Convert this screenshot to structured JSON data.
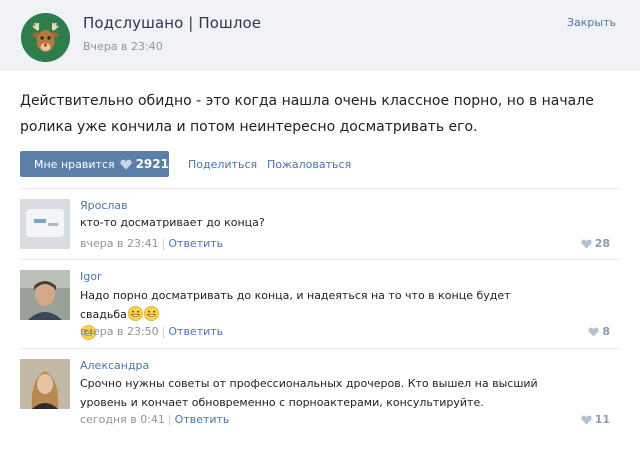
{
  "header": {
    "title": "Подслушано | Пошлое",
    "time": "Вчера в 23:40",
    "close_label": "Закрыть"
  },
  "post": {
    "text": "Действительно обидно - это когда нашла очень классное порно, но в начале ролика уже кончила и потом неинтересно досматривать его."
  },
  "actions": {
    "like_label": "Мне нравится",
    "like_count": "2921",
    "share_label": "Поделиться",
    "report_label": "Пожаловаться"
  },
  "comments": [
    {
      "author": "Ярослав",
      "text": "кто-то досматривает до конца?",
      "time": "вчера в 23:41",
      "reply_label": "Ответить",
      "likes": "28"
    },
    {
      "author": "Igor",
      "text": "Надо порно досматривать до конца, и надеяться на то что в конце будет свадьба",
      "time": "вчера в 23:50",
      "reply_label": "Ответить",
      "likes": "8"
    },
    {
      "author": "Александра",
      "text": "Срочно нужны советы от профессиональных дрочеров. Кто вышел на высший уровень и кончает обновременно с порноактерами, консультируйте.",
      "time": "сегодня в 0:41",
      "reply_label": "Ответить",
      "likes": "11"
    }
  ],
  "colors": {
    "link": "#4a76a8",
    "like_button": "#5b7fa6",
    "header_bg": "#f0f2f5"
  }
}
